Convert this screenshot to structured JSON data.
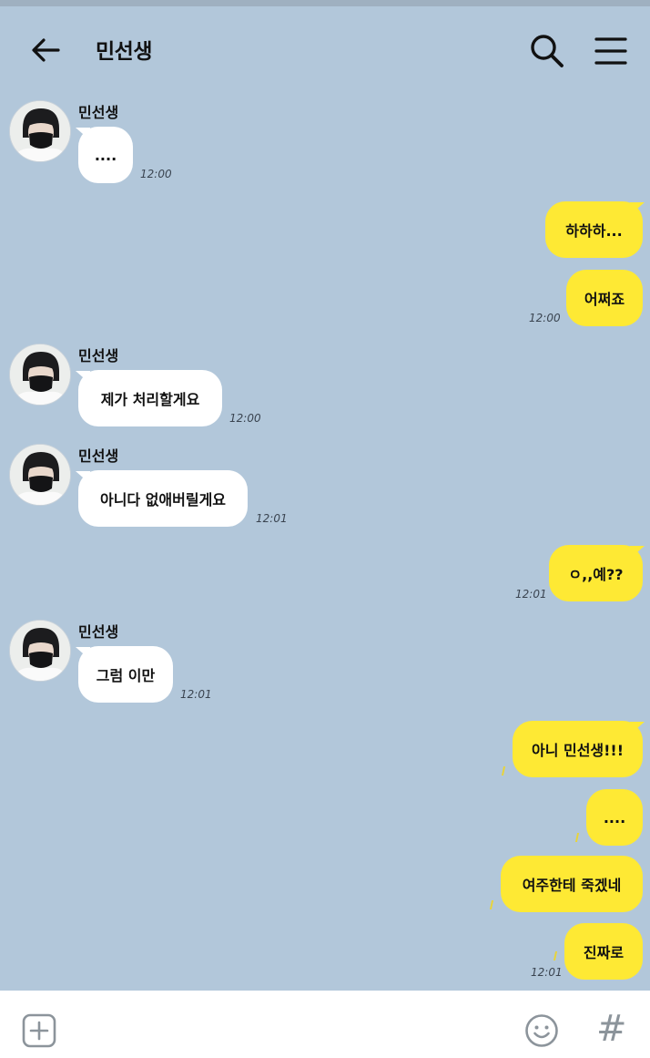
{
  "header": {
    "title": "민선생"
  },
  "messages": [
    {
      "sender": "민선생",
      "text": "....",
      "time": "12:00"
    },
    {
      "text": "하하하..."
    },
    {
      "text": "어쩌죠",
      "time": "12:00"
    },
    {
      "sender": "민선생",
      "text": "제가 처리할게요",
      "time": "12:00"
    },
    {
      "sender": "민선생",
      "text": "아니다 없애버릴게요",
      "time": "12:01"
    },
    {
      "text": "ㅇ,,예??",
      "time": "12:01"
    },
    {
      "sender": "민선생",
      "text": "그럼 이만",
      "time": "12:01"
    },
    {
      "text": "아니 민선생!!!"
    },
    {
      "text": "...."
    },
    {
      "text": "여주한테 죽겠네"
    },
    {
      "text": "진짜로",
      "time": "12:01"
    }
  ],
  "icons": {
    "back": "arrow-left-icon",
    "search": "search-icon",
    "menu": "menu-icon",
    "attach": "plus-square-icon",
    "emoji": "emoji-icon",
    "hashtag": "hash-icon"
  },
  "colors": {
    "background": "#b2c7da",
    "outgoing_bubble": "#fee934",
    "incoming_bubble": "#ffffff"
  },
  "bottom_bar": {
    "hash_symbol": "#"
  }
}
